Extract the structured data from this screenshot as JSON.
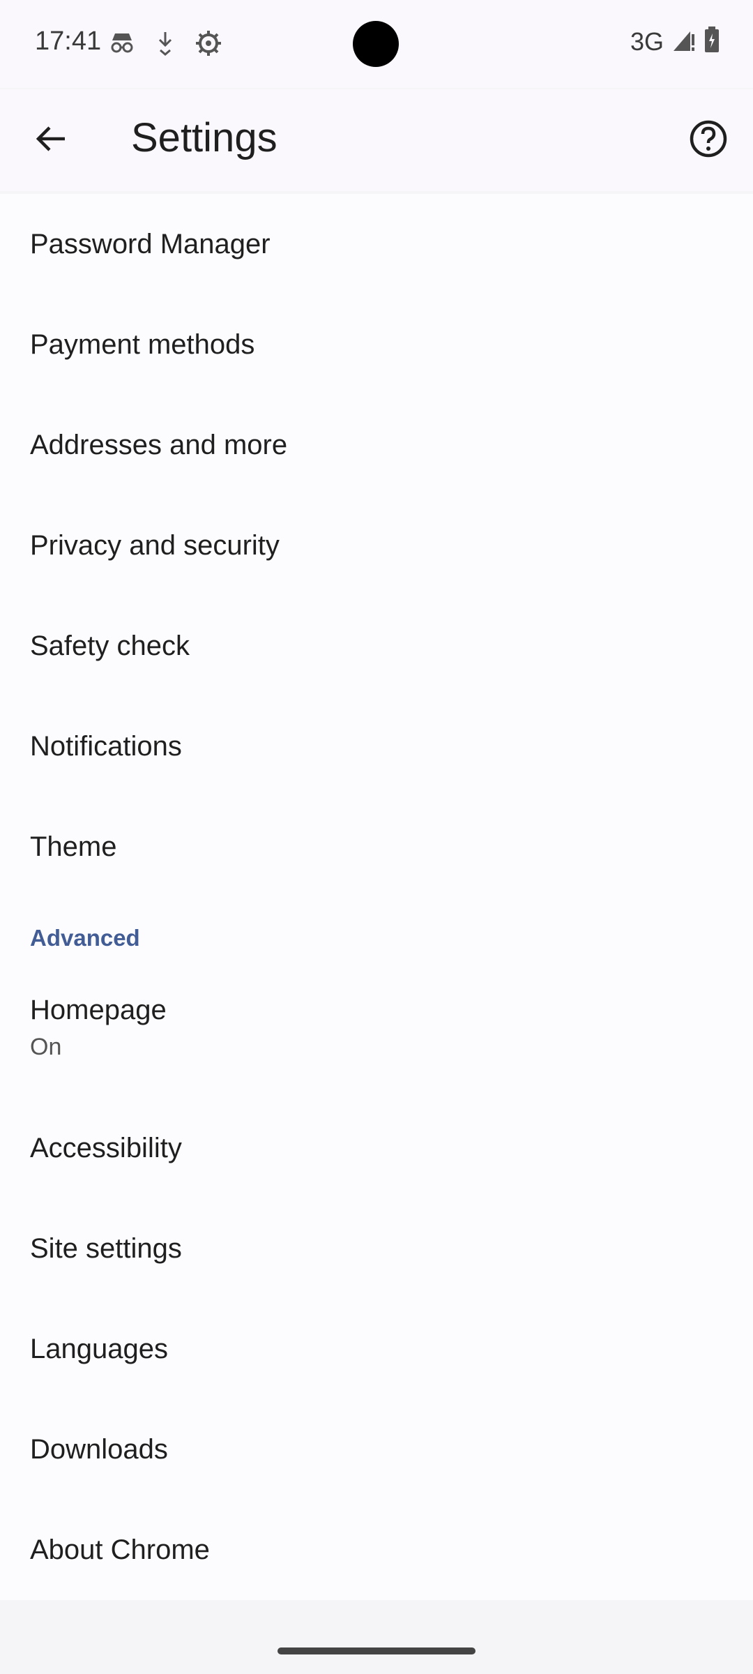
{
  "status_bar": {
    "time": "17:41",
    "network": "3G",
    "icons": [
      "incognito-icon",
      "download-icon",
      "settings-gear-icon",
      "signal-icon",
      "battery-icon"
    ]
  },
  "toolbar": {
    "back_icon": "back-arrow-icon",
    "title": "Settings",
    "help_icon": "help-icon"
  },
  "list": {
    "password_manager": "Password Manager",
    "payment_methods": "Payment methods",
    "addresses": "Addresses and more",
    "privacy": "Privacy and security",
    "safety_check": "Safety check",
    "notifications": "Notifications",
    "theme": "Theme",
    "advanced_header": "Advanced",
    "homepage": "Homepage",
    "homepage_summary": "On",
    "accessibility": "Accessibility",
    "site_settings": "Site settings",
    "languages": "Languages",
    "downloads": "Downloads",
    "about_chrome": "About Chrome"
  },
  "colors": {
    "accent": "#425d95",
    "background": "#fcfbfe"
  }
}
